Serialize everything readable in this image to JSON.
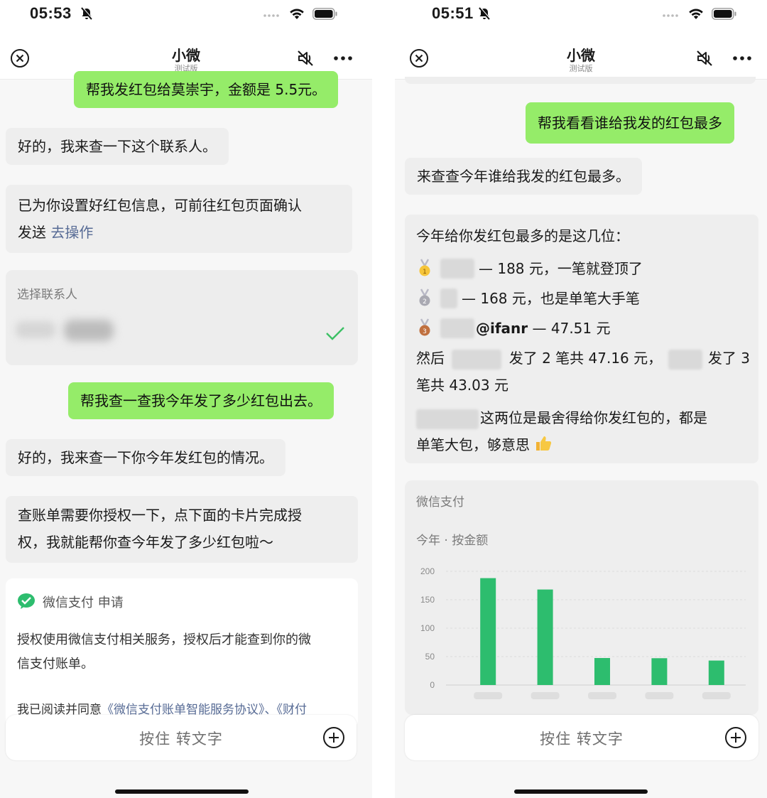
{
  "left": {
    "status_time": "05:53",
    "nav": {
      "title": "小微",
      "subtitle": "测试版"
    },
    "messages": {
      "m1": "帮我发红包给莫崇宇，金额是 5.5元。",
      "m2": "好的，我来查一下这个联系人。",
      "m3_line1": "已为你设置好红包信息，可前往红包页面确认",
      "m3_line2": "发送",
      "m3_link": "去操作",
      "m5": "帮我查一查我今年发了多少红包出去。",
      "m6": "好的，我来查一下你今年发红包的情况。",
      "m7_line1": "查账单需要你授权一下，点下面的卡片完成授",
      "m7_line2": "权，我就能帮你查今年发了多少红包啦～"
    },
    "contact_card": {
      "label": "选择联系人"
    },
    "auth_card": {
      "title": "微信支付 申请",
      "body_line1": "授权使用微信支付相关服务，授权后才能查到你的微",
      "body_line2": "信支付账单。",
      "agree_prefix": "我已阅读并同意",
      "agree_link": "《微信支付账单智能服务协议》、《财付"
    },
    "input_hint": "按住 转文字"
  },
  "right": {
    "status_time": "05:51",
    "nav": {
      "title": "小微",
      "subtitle": "测试版"
    },
    "messages": {
      "m1": "帮我看看谁给我发的红包最多",
      "m2": "来查查今年谁给我发的红包最多。",
      "r_title": "今年给你发红包最多的是这几位：",
      "r_l1": "— 188 元，一笔就登顶了",
      "r_l2": "— 168 元，也是单笔大手笔",
      "r_l3_name": "@ifanr",
      "r_l3": "— 47.51 元",
      "r_l4_a": "然后",
      "r_l4_b": "发了 2 笔共 47.16 元，",
      "r_l4_c": "发了 3",
      "r_l5": "笔共 43.03 元",
      "r_l6": "这两位是最舍得给你发红包的，都是",
      "r_l7": "单笔大包，够意思"
    },
    "pay_card": {
      "title": "微信支付",
      "subtitle": "今年 · 按金额"
    },
    "input_hint": "按住 转文字"
  },
  "chart_data": {
    "type": "bar",
    "categories": [
      "",
      "",
      "",
      "",
      ""
    ],
    "values": [
      188,
      168,
      47.51,
      47.16,
      43.03
    ],
    "yticks": [
      "200",
      "150",
      "100",
      "50",
      "0"
    ],
    "ylim": [
      0,
      200
    ],
    "grid": true,
    "bar_color": "#2dbd6e"
  },
  "colors": {
    "me_bubble": "#95ec69",
    "bot_bubble": "#eeeeee",
    "link": "#576b95",
    "check": "#3cc065"
  }
}
